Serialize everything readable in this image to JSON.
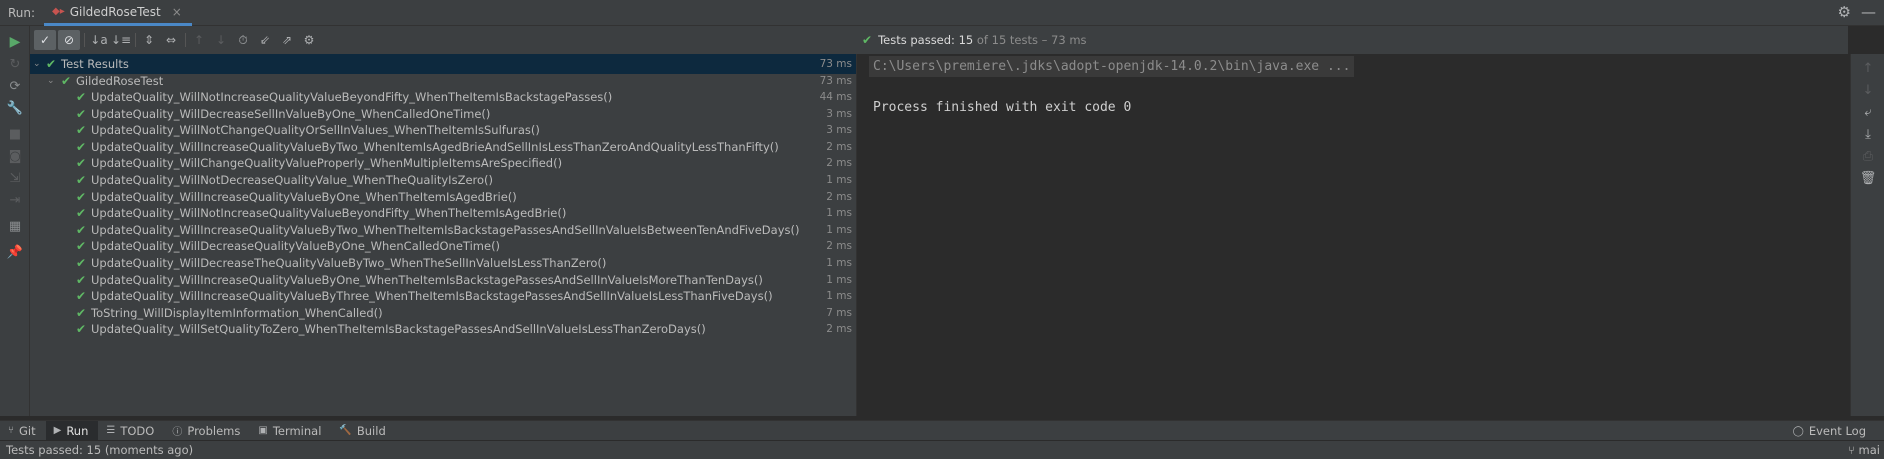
{
  "header": {
    "run_label": "Run:",
    "tab_title": "GildedRoseTest",
    "tab_icon": "test-config-icon",
    "close": "×",
    "settings_icon": "gear-icon",
    "minimize_icon": "minimize-icon"
  },
  "left_toolbar": {
    "icons": [
      "rerun-icon",
      "rerun-failed-icon",
      "toggle-autotest-icon",
      "wrench-icon",
      "stop-icon",
      "camera-icon",
      "export-icon",
      "restore-layout-icon",
      "layout-icon",
      "pin-icon"
    ]
  },
  "tree_toolbar": {
    "icons": [
      "show-passed-icon",
      "show-ignored-icon",
      "sort-alpha-icon",
      "sort-duration-icon",
      "expand-all-icon",
      "collapse-all-icon",
      "previous-test-icon",
      "next-test-icon",
      "history-icon",
      "import-tests-icon",
      "export-tests-icon",
      "settings-icon"
    ]
  },
  "summary": {
    "prefix": "Tests passed:",
    "passed": "15",
    "rest": "of 15 tests – 73 ms"
  },
  "tree": {
    "root": {
      "name": "Test Results",
      "time": "73 ms"
    },
    "suite": {
      "name": "GildedRoseTest",
      "time": "73 ms"
    },
    "tests": [
      {
        "name": "UpdateQuality_WillNotIncreaseQualityValueBeyondFifty_WhenTheItemIsBackstagePasses()",
        "time": "44 ms"
      },
      {
        "name": "UpdateQuality_WillDecreaseSellInValueByOne_WhenCalledOneTime()",
        "time": "3 ms"
      },
      {
        "name": "UpdateQuality_WillNotChangeQualityOrSellInValues_WhenTheItemIsSulfuras()",
        "time": "3 ms"
      },
      {
        "name": "UpdateQuality_WillIncreaseQualityValueByTwo_WhenItemIsAgedBrieAndSellInIsLessThanZeroAndQualityLessThanFifty()",
        "time": "2 ms"
      },
      {
        "name": "UpdateQuality_WillChangeQualityValueProperly_WhenMultipleItemsAreSpecified()",
        "time": "2 ms"
      },
      {
        "name": "UpdateQuality_WillNotDecreaseQualityValue_WhenTheQualityIsZero()",
        "time": "1 ms"
      },
      {
        "name": "UpdateQuality_WillIncreaseQualityValueByOne_WhenTheItemIsAgedBrie()",
        "time": "2 ms"
      },
      {
        "name": "UpdateQuality_WillNotIncreaseQualityValueBeyondFifty_WhenTheItemIsAgedBrie()",
        "time": "1 ms"
      },
      {
        "name": "UpdateQuality_WillIncreaseQualityValueByTwo_WhenTheItemIsBackstagePassesAndSellInValueIsBetweenTenAndFiveDays()",
        "time": "1 ms"
      },
      {
        "name": "UpdateQuality_WillDecreaseQualityValueByOne_WhenCalledOneTime()",
        "time": "2 ms"
      },
      {
        "name": "UpdateQuality_WillDecreaseTheQualityValueByTwo_WhenTheSellInValueIsLessThanZero()",
        "time": "1 ms"
      },
      {
        "name": "UpdateQuality_WillIncreaseQualityValueByOne_WhenTheItemIsBackstagePassesAndSellInValueIsMoreThanTenDays()",
        "time": "1 ms"
      },
      {
        "name": "UpdateQuality_WillIncreaseQualityValueByThree_WhenTheItemIsBackstagePassesAndSellInValueIsLessThanFiveDays()",
        "time": "1 ms"
      },
      {
        "name": "ToString_WillDisplayItemInformation_WhenCalled()",
        "time": "7 ms"
      },
      {
        "name": "UpdateQuality_WillSetQualityToZero_WhenTheItemIsBackstagePassesAndSellInValueIsLessThanZeroDays()",
        "time": "2 ms"
      }
    ]
  },
  "console": {
    "command": "C:\\Users\\premiere\\.jdks\\adopt-openjdk-14.0.2\\bin\\java.exe ...",
    "exit": "Process finished with exit code 0"
  },
  "right_toolbar": {
    "icons": [
      "up-icon",
      "down-icon",
      "soft-wrap-icon",
      "scroll-to-end-icon",
      "print-icon",
      "trash-icon"
    ]
  },
  "tool_windows": [
    {
      "label": "Git",
      "icon": "git-icon"
    },
    {
      "label": "Run",
      "icon": "run-icon",
      "active": true
    },
    {
      "label": "TODO",
      "icon": "todo-icon"
    },
    {
      "label": "Problems",
      "icon": "problems-icon"
    },
    {
      "label": "Terminal",
      "icon": "terminal-icon"
    },
    {
      "label": "Build",
      "icon": "build-icon"
    }
  ],
  "event_log": {
    "label": "Event Log",
    "icon": "event-log-icon"
  },
  "status_bar": {
    "message": "Tests passed: 15 (moments ago)",
    "branch": "mai"
  },
  "colors": {
    "pass": "#5fb865",
    "selection": "#0d293e",
    "accent": "#4a88c7"
  }
}
